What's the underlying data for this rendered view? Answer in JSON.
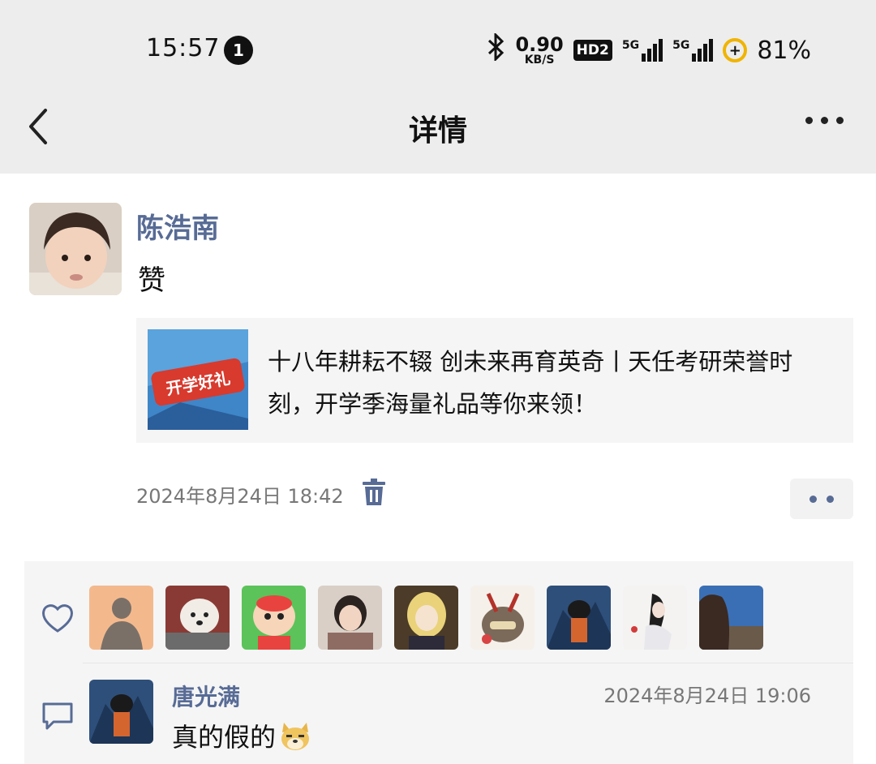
{
  "status_bar": {
    "time": "15:57",
    "notification_count": "1",
    "net_speed_value": "0.90",
    "net_speed_unit": "KB/S",
    "hd_badge": "HD2",
    "signal_1_label": "5G",
    "signal_2_label": "5G",
    "battery_symbol": "+",
    "battery_percent": "81%"
  },
  "header": {
    "title": "详情",
    "back_icon": "chevron-left-icon",
    "more_icon": "more-dots-icon"
  },
  "post": {
    "author": "陈浩南",
    "text": "赞",
    "share": {
      "thumb_text": "开学好礼",
      "title": "十八年耕耘不辍 创未来再育英奇丨天任考研荣誉时刻，开学季海量礼品等你来领！"
    },
    "time": "2024年8月24日 18:42"
  },
  "likes": {
    "icon": "heart-icon",
    "count_avatars": 9
  },
  "comments": [
    {
      "author": "唐光满",
      "time": "2024年8月24日 19:06",
      "text": "真的假的"
    }
  ],
  "colors": {
    "link_blue": "#576b95",
    "header_bg": "#ededed",
    "panel_bg": "#f5f5f5"
  }
}
